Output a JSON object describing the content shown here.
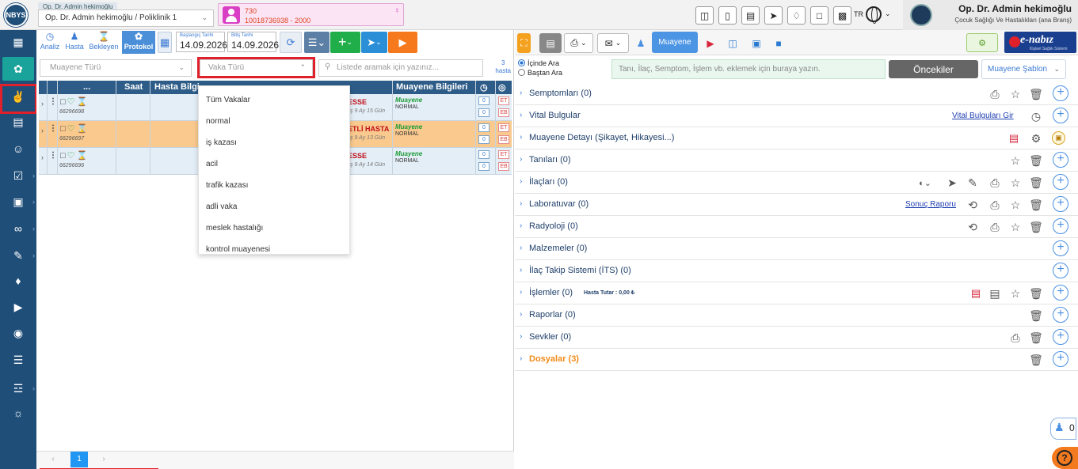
{
  "app": {
    "logo": "NBYS",
    "lang": "TR"
  },
  "doctor_select": {
    "tag": "Op. Dr. Admin hekimoğlu",
    "value": "Op. Dr. Admin hekimoğlu / Poliklinik 1"
  },
  "patient_card": {
    "line1": "730",
    "line2": "10018736938 - 2000"
  },
  "user": {
    "name": "Op. Dr. Admin hekimoğlu",
    "dept": "Çocuk Sağlığı Ve Hastalıkları (ana Branş)"
  },
  "left_tabs": [
    {
      "label": "Analiz",
      "icon": "chart-icon"
    },
    {
      "label": "Hasta",
      "icon": "person-icon"
    },
    {
      "label": "Bekleyen",
      "icon": "hourglass-icon"
    },
    {
      "label": "Protokol",
      "icon": "stethoscope-icon"
    }
  ],
  "dates": {
    "start_label": "Başlangıç Tarihi",
    "start": "14.09.2026",
    "end_label": "Bitiş Tarihi",
    "end": "14.09.2026"
  },
  "filters": {
    "muayene_placeholder": "Muayene Türü",
    "vaka_placeholder": "Vaka Türü",
    "search_placeholder": "Listede aramak için yazınız...",
    "count": "3",
    "count_label": "hasta"
  },
  "grid": {
    "headers": {
      "more": "...",
      "saat": "Saat",
      "hasta": "Hasta Bilgi",
      "muayene": "Muayene Bilgileri"
    },
    "rows": [
      {
        "pid": "66296698",
        "name": "ESSE",
        "age": "ş 9 Ay 15 Gün",
        "status": "Muayene",
        "sub": "NORMAL",
        "c1": "0",
        "c2": "0",
        "e1": "ET",
        "e2": "EB",
        "color": "blue"
      },
      {
        "pid": "66296697",
        "name": "ETLİ HASTA",
        "age": "ş 9 Ay 13 Gün",
        "status": "Muayene",
        "sub": "NORMAL",
        "c1": "0",
        "c2": "0",
        "e1": "ET",
        "e2": "EB",
        "color": "orange"
      },
      {
        "pid": "66296696",
        "name": "ESSE",
        "age": "ş 9 Ay 14 Gün",
        "status": "Muayene",
        "sub": "NORMAL",
        "c1": "0",
        "c2": "0",
        "e1": "ET",
        "e2": "EB",
        "color": "blue"
      }
    ]
  },
  "pager": {
    "prev": "‹",
    "page": "1",
    "next": "›"
  },
  "vaka_dropdown": [
    "Tüm Vakalar",
    "normal",
    "iş kazası",
    "acil",
    "trafik kazası",
    "adli vaka",
    "meslek hastalığı",
    "kontrol muayenesi"
  ],
  "right_toolbar": {
    "muayene": "Muayene",
    "enabiz": "e-nabız",
    "enabiz_sub": "Kişisel Sağlık Sistemi"
  },
  "search_panel": {
    "radio1": "İçinde Ara",
    "radio2": "Baştan Ara",
    "placeholder": "Tanı, İlaç, Semptom, İşlem vb. eklemek için buraya yazın.",
    "oncekiler": "Öncekiler",
    "sablon": "Muayene Şablon"
  },
  "sections": [
    {
      "title": "Semptomları (0)"
    },
    {
      "title": "Vital Bulgular",
      "link": "Vital Bulguları Gir"
    },
    {
      "title": "Muayene Detayı (Şikayet, Hikayesi...)"
    },
    {
      "title": "Tanıları (0)"
    },
    {
      "title": "İlaçları (0)"
    },
    {
      "title": "Laboratuvar (0)",
      "link": "Sonuç Raporu"
    },
    {
      "title": "Radyoloji (0)"
    },
    {
      "title": "Malzemeler (0)"
    },
    {
      "title": "İlaç Takip Sistemi (İTS) (0)"
    },
    {
      "title": "İşlemler (0)",
      "note": "Hasta Tutar : 0,00 ₺"
    },
    {
      "title": "Raporlar (0)"
    },
    {
      "title": "Sevkler (0)"
    },
    {
      "title": "Dosyalar (3)"
    }
  ],
  "fab": {
    "count": "0",
    "help": "?"
  }
}
